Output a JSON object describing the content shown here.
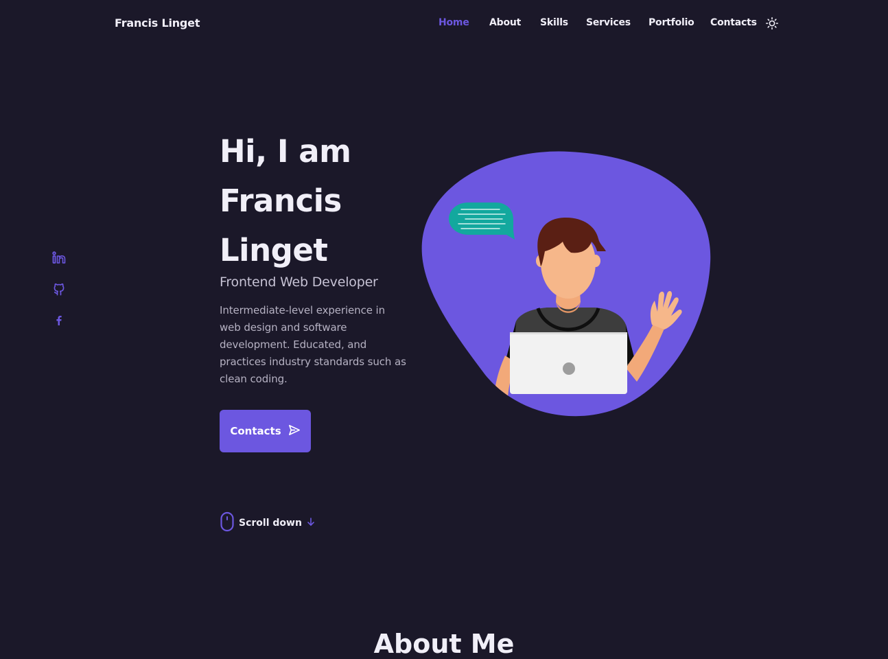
{
  "header": {
    "logo": "Francis Linget",
    "nav": [
      {
        "label": "Home",
        "active": true
      },
      {
        "label": "About"
      },
      {
        "label": "Skills"
      },
      {
        "label": "Services"
      },
      {
        "label": "Portfolio"
      },
      {
        "label": "Contacts"
      }
    ],
    "theme_toggle_icon": "sun-icon"
  },
  "social": [
    {
      "icon": "linkedin-icon"
    },
    {
      "icon": "github-icon"
    },
    {
      "icon": "facebook-icon"
    }
  ],
  "hero": {
    "title_lines": [
      "Hi, I am",
      "Francis",
      "Linget"
    ],
    "subtitle": "Frontend Web Developer",
    "description": "Intermediate-level experience in web design and software development. Educated, and practices industry standards such as clean coding.",
    "contact_button_label": "Contacts",
    "contact_button_icon": "send-icon",
    "scroll_label": "Scroll down",
    "scroll_icons": [
      "mouse-icon",
      "arrow-down-icon"
    ]
  },
  "next_section": {
    "title": "About Me"
  },
  "colors": {
    "background": "#1b1829",
    "accent": "#6c57e0",
    "text": "#f1eff8",
    "muted_text": "#b6b2c3"
  }
}
